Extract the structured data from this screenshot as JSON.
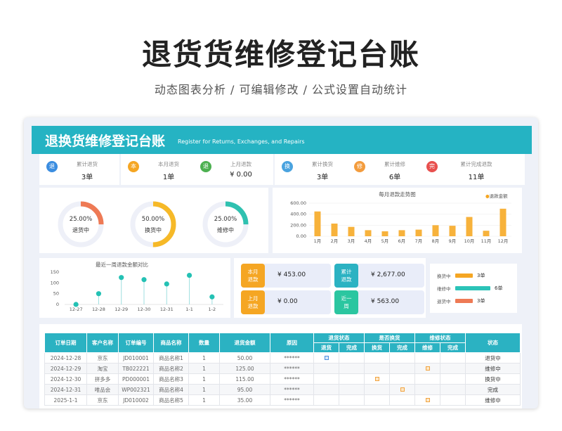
{
  "hero": {
    "title": "退货货维修登记台账",
    "subtitle": "动态图表分析 /  可编辑修改  /  公式设置自动统计"
  },
  "banner": {
    "title": "退换货维修登记台账",
    "subtitle": "Register for Returns, Exchanges, and Repairs"
  },
  "kpis": [
    {
      "icon": "退",
      "label": "累计退货",
      "value": "3单",
      "color": "#3b8de0"
    },
    {
      "icon": "本",
      "label": "本月退货",
      "value": "1单",
      "color": "#f5a623"
    },
    {
      "icon": "退",
      "label": "上月退款",
      "value": "¥ 0.00",
      "color": "#4cb050"
    },
    {
      "icon": "换",
      "label": "累计换货",
      "value": "3单",
      "color": "#4aa3df"
    },
    {
      "icon": "修",
      "label": "累计维修",
      "value": "6单",
      "color": "#f39c3d"
    },
    {
      "icon": "完",
      "label": "累计完成退款",
      "value": "11单",
      "color": "#e8504e"
    }
  ],
  "donuts": [
    {
      "pct": "25.00%",
      "name": "退货中",
      "value": 0.25,
      "color": "#ee7a55"
    },
    {
      "pct": "50.00%",
      "name": "换货中",
      "value": 0.5,
      "color": "#f6b928"
    },
    {
      "pct": "25.00%",
      "name": "维修中",
      "value": 0.25,
      "color": "#2fc1b0"
    }
  ],
  "monthly_chart": {
    "title": "每月退款走势图",
    "legend": "退款金额",
    "y_ticks": [
      "600.00",
      "400.00",
      "200.00",
      "0.00"
    ]
  },
  "weekly_chart": {
    "title": "最近一周退款金额对比",
    "y_ticks": [
      "150",
      "100",
      "50",
      "0"
    ]
  },
  "chart_data": [
    {
      "type": "bar",
      "title": "每月退款走势图",
      "categories": [
        "1月",
        "2月",
        "3月",
        "4月",
        "5月",
        "6月",
        "7月",
        "8月",
        "9月",
        "10月",
        "11月",
        "12月"
      ],
      "series": [
        {
          "name": "退款金额",
          "values": [
            450,
            230,
            170,
            110,
            90,
            110,
            120,
            200,
            190,
            350,
            100,
            500
          ]
        }
      ],
      "ylim": [
        0,
        600
      ]
    },
    {
      "type": "scatter",
      "title": "最近一周退款金额对比",
      "categories": [
        "12-27",
        "12-28",
        "12-29",
        "12-30",
        "12-31",
        "1-1",
        "1-2"
      ],
      "values": [
        0,
        50,
        125,
        115,
        95,
        135,
        35
      ],
      "ylim": [
        0,
        150
      ]
    }
  ],
  "stats": [
    {
      "badge": "本月\n退款",
      "value": "¥ 453.00",
      "color": "#f5a623"
    },
    {
      "badge": "累计\n退款",
      "value": "¥ 2,677.00",
      "color": "#2bb2c2"
    },
    {
      "badge": "上月\n退款",
      "value": "¥ 0.00",
      "color": "#f5a623"
    },
    {
      "badge": "近一\n周",
      "value": "¥ 563.00",
      "color": "#2bc6a0"
    }
  ],
  "legend": [
    {
      "label": "换货中",
      "value": "3单",
      "amount": 3,
      "color": "#f5a623"
    },
    {
      "label": "维修中",
      "value": "6单",
      "amount": 6,
      "color": "#2bc3b8"
    },
    {
      "label": "退货中",
      "value": "3单",
      "amount": 3,
      "color": "#ee7a55"
    }
  ],
  "table": {
    "headers": {
      "date": "订单日期",
      "customer": "客户名称",
      "order": "订单编号",
      "product": "商品名称",
      "qty": "数量",
      "amount": "退货金额",
      "reason": "原因",
      "return_status": "退货状态",
      "exchange": "是否换货",
      "repair_status": "维修状态",
      "status": "状态",
      "return_sub": [
        "退货",
        "完成"
      ],
      "exchange_sub": [
        "换货",
        "完成"
      ],
      "repair_sub": [
        "维修",
        "完成"
      ]
    },
    "rows": [
      {
        "date": "2024-12-28",
        "customer": "京东",
        "order": "JD010001",
        "product": "商品名称1",
        "qty": "1",
        "amount": "50.00",
        "reason": "******",
        "status": "退货中"
      },
      {
        "date": "2024-12-29",
        "customer": "淘宝",
        "order": "TB022221",
        "product": "商品名称2",
        "qty": "1",
        "amount": "125.00",
        "reason": "******",
        "status": "维修中"
      },
      {
        "date": "2024-12-30",
        "customer": "拼多多",
        "order": "PD000001",
        "product": "商品名称3",
        "qty": "1",
        "amount": "115.00",
        "reason": "******",
        "status": "换货中"
      },
      {
        "date": "2024-12-31",
        "customer": "唯品会",
        "order": "WP002321",
        "product": "商品名称4",
        "qty": "1",
        "amount": "95.00",
        "reason": "******",
        "status": "完成"
      },
      {
        "date": "2025-1-1",
        "customer": "京东",
        "order": "JD010002",
        "product": "商品名称5",
        "qty": "1",
        "amount": "35.00",
        "reason": "******",
        "status": "维修中"
      }
    ]
  }
}
